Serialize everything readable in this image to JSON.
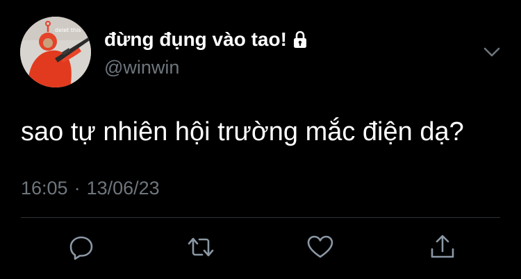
{
  "tweet": {
    "display_name": "đừng đụng vào tao!",
    "handle": "@winwin",
    "text": "sao tự nhiên hội trường mắc điện dạ?",
    "time": "16:05",
    "separator": "·",
    "date": "13/06/23",
    "avatar_caption": "delet this"
  },
  "icons": {
    "protected": "lock-icon",
    "more": "chevron-down-icon",
    "reply": "reply-icon",
    "retweet": "retweet-icon",
    "like": "heart-icon",
    "share": "share-icon"
  },
  "colors": {
    "background": "#000000",
    "text": "#ffffff",
    "secondary": "#6e767d",
    "divider": "#2f3336",
    "icon": "#8b98a5"
  }
}
